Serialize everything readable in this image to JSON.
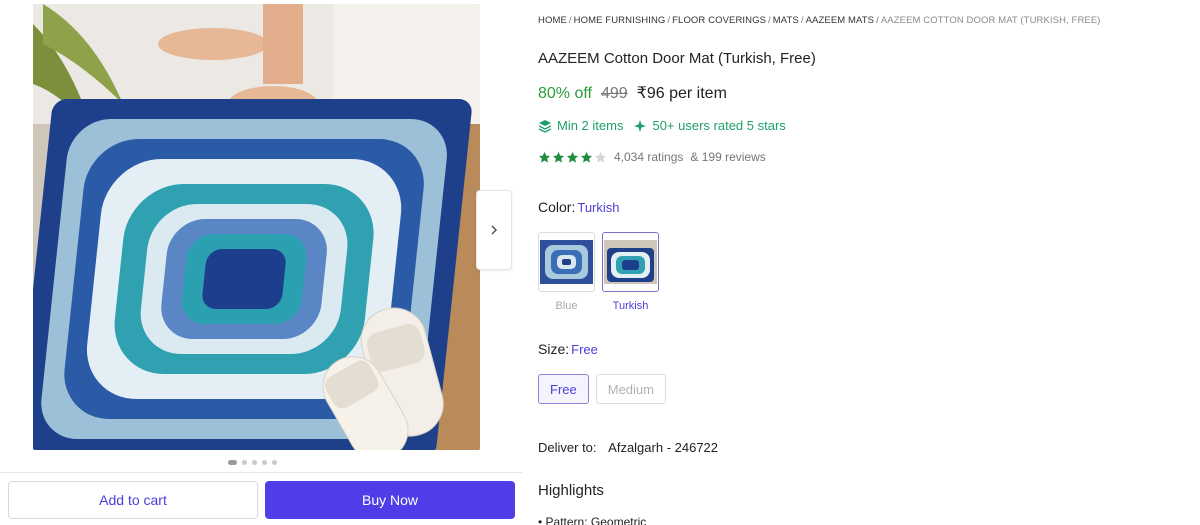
{
  "gallery": {
    "image_alt": "Blue and turquoise wavy pattern door mat with slippers",
    "dot_count": 5,
    "active_dot": 0
  },
  "actions": {
    "add_to_cart": "Add to cart",
    "buy_now": "Buy Now"
  },
  "breadcrumb": {
    "items": [
      "HOME",
      "HOME FURNISHING",
      "FLOOR COVERINGS",
      "MATS",
      "AAZEEM MATS"
    ],
    "current": "AAZEEM COTTON DOOR MAT (TURKISH, FREE)",
    "separator": "/"
  },
  "product": {
    "title": "AAZEEM Cotton Door Mat (Turkish, Free)",
    "discount": "80% off",
    "mrp": "499",
    "price": "₹96 per item",
    "offers": {
      "min_items": "Min 2 items",
      "users_rated": "50+ users rated 5 stars"
    },
    "rating": {
      "stars": 4,
      "max_stars": 5,
      "ratings_text": "4,034 ratings",
      "reviews_text": "& 199 reviews"
    }
  },
  "color": {
    "label": "Color:",
    "selected": "Turkish",
    "options": [
      {
        "name": "Blue",
        "selected": false
      },
      {
        "name": "Turkish",
        "selected": true
      }
    ]
  },
  "size": {
    "label": "Size:",
    "selected": "Free",
    "options": [
      {
        "name": "Free",
        "selected": true
      },
      {
        "name": "Medium",
        "selected": false
      }
    ]
  },
  "delivery": {
    "label": "Deliver to:",
    "location": "Afzalgarh - 246722"
  },
  "highlights": {
    "title": "Highlights",
    "first_item": "• Pattern: Geometric"
  },
  "colors": {
    "accent": "#4f3ee8",
    "link": "#4a3fd6",
    "discount_green": "#2a9d3a",
    "offer_teal": "#1f9f6a",
    "star_green": "#1e8e3e"
  },
  "icons": {
    "next": "chevron-right-icon",
    "min_items": "layers-icon",
    "users_rated": "sparkle-icon",
    "star": "star-icon"
  }
}
